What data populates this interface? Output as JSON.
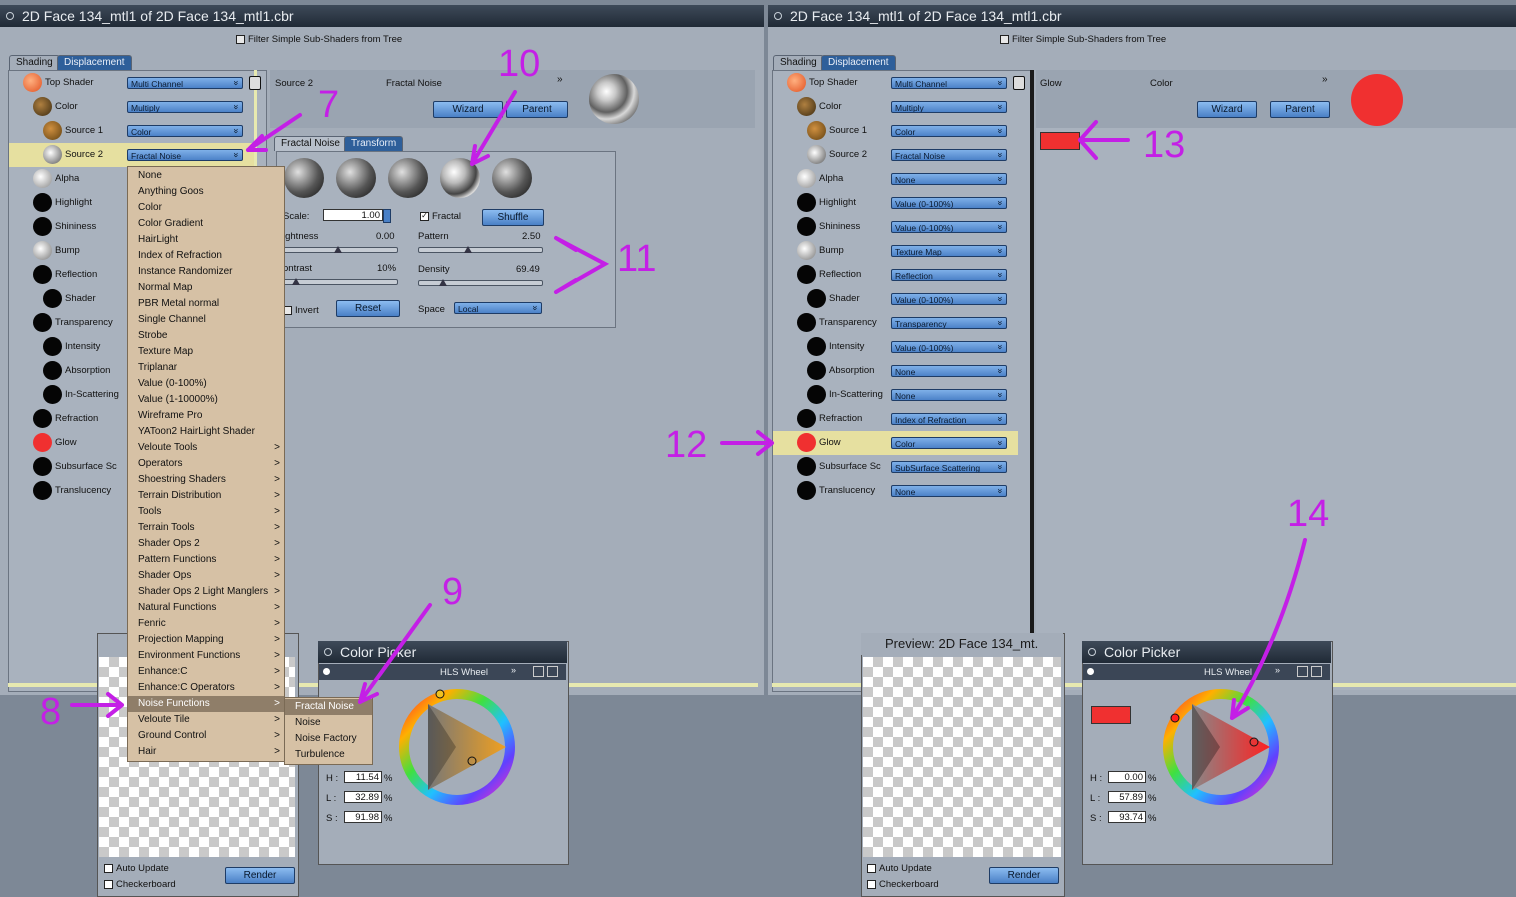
{
  "left_window": {
    "title": "2D Face 134_mtl1 of 2D Face 134_mtl1.cbr",
    "filter_label": "Filter Simple Sub-Shaders from Tree",
    "tabs": [
      "Shading",
      "Displacement"
    ],
    "tree": [
      {
        "label": "Top Shader",
        "value": "Multi Channel"
      },
      {
        "label": "Color",
        "value": "Multiply"
      },
      {
        "label": "Source 1",
        "value": "Color"
      },
      {
        "label": "Source 2",
        "value": "Fractal Noise"
      },
      {
        "label": "Alpha",
        "value": ""
      },
      {
        "label": "Highlight",
        "value": ""
      },
      {
        "label": "Shininess",
        "value": ""
      },
      {
        "label": "Bump",
        "value": ""
      },
      {
        "label": "Reflection",
        "value": ""
      },
      {
        "label": "Shader",
        "value": ""
      },
      {
        "label": "Transparency",
        "value": ""
      },
      {
        "label": "Intensity",
        "value": ""
      },
      {
        "label": "Absorption",
        "value": ""
      },
      {
        "label": "In-Scattering",
        "value": ""
      },
      {
        "label": "Refraction",
        "value": ""
      },
      {
        "label": "Glow",
        "value": ""
      },
      {
        "label": "Subsurface Sc",
        "value": ""
      },
      {
        "label": "Translucency",
        "value": ""
      }
    ],
    "source_header": {
      "name": "Source 2",
      "type": "Fractal Noise",
      "wizard": "Wizard",
      "parent": "Parent"
    },
    "subtabs": [
      "Fractal Noise",
      "Transform"
    ],
    "params": {
      "scale_label": "Scale:",
      "scale_value": "1.00",
      "fractal_label": "Fractal",
      "shuffle": "Shuffle",
      "brightness_label": "ightness",
      "brightness_value": "0.00",
      "pattern_label": "Pattern",
      "pattern_value": "2.50",
      "contrast_label": "ontrast",
      "contrast_value": "10%",
      "density_label": "Density",
      "density_value": "69.49",
      "invert_label": "Invert",
      "reset": "Reset",
      "space_label": "Space",
      "space_value": "Local"
    }
  },
  "context_menu": {
    "items": [
      {
        "label": "None",
        "sub": ""
      },
      {
        "label": "Anything Goos",
        "sub": ""
      },
      {
        "label": "Color",
        "sub": ""
      },
      {
        "label": "Color Gradient",
        "sub": ""
      },
      {
        "label": "HairLight",
        "sub": ""
      },
      {
        "label": "Index of Refraction",
        "sub": ""
      },
      {
        "label": "Instance Randomizer",
        "sub": ""
      },
      {
        "label": "Normal Map",
        "sub": ""
      },
      {
        "label": "PBR Metal normal",
        "sub": ""
      },
      {
        "label": "Single Channel",
        "sub": ""
      },
      {
        "label": "Strobe",
        "sub": ""
      },
      {
        "label": "Texture Map",
        "sub": ""
      },
      {
        "label": "Triplanar",
        "sub": ""
      },
      {
        "label": "Value (0-100%)",
        "sub": ""
      },
      {
        "label": "Value (1-10000%)",
        "sub": ""
      },
      {
        "label": "Wireframe Pro",
        "sub": ""
      },
      {
        "label": "YAToon2 HairLight Shader",
        "sub": ""
      },
      {
        "label": "Veloute Tools",
        "sub": ">"
      },
      {
        "label": "Operators",
        "sub": ">"
      },
      {
        "label": "Shoestring Shaders",
        "sub": ">"
      },
      {
        "label": "Terrain Distribution",
        "sub": ">"
      },
      {
        "label": "Tools",
        "sub": ">"
      },
      {
        "label": "Terrain Tools",
        "sub": ">"
      },
      {
        "label": "Shader Ops 2",
        "sub": ">"
      },
      {
        "label": "Pattern Functions",
        "sub": ">"
      },
      {
        "label": "Shader Ops",
        "sub": ">"
      },
      {
        "label": "Shader Ops 2 Light Manglers",
        "sub": ">"
      },
      {
        "label": "Natural Functions",
        "sub": ">"
      },
      {
        "label": "Fenric",
        "sub": ">"
      },
      {
        "label": "Projection Mapping",
        "sub": ">"
      },
      {
        "label": "Environment Functions",
        "sub": ">"
      },
      {
        "label": "Enhance:C",
        "sub": ">"
      },
      {
        "label": "Enhance:C Operators",
        "sub": ">"
      },
      {
        "label": "Noise Functions",
        "sub": ">"
      },
      {
        "label": "Veloute Tile",
        "sub": ">"
      },
      {
        "label": "Ground Control",
        "sub": ">"
      },
      {
        "label": "Hair",
        "sub": ">"
      }
    ],
    "submenu": [
      "Fractal Noise",
      "Noise",
      "Noise Factory",
      "Turbulence"
    ]
  },
  "left_preview": {
    "auto_update": "Auto Update",
    "checkerboard": "Checkerboard",
    "render": "Render"
  },
  "left_color_picker": {
    "title": "Color Picker",
    "mode": "HLS Wheel",
    "h": "11.54",
    "l": "32.89",
    "s": "91.98",
    "h_label": "H :",
    "l_label": "L :",
    "s_label": "S :",
    "pct": "%"
  },
  "right_window": {
    "title": "2D Face 134_mtl1 of 2D Face 134_mtl1.cbr",
    "filter_label": "Filter Simple Sub-Shaders from Tree",
    "tabs": [
      "Shading",
      "Displacement"
    ],
    "tree": [
      {
        "label": "Top Shader",
        "value": "Multi Channel"
      },
      {
        "label": "Color",
        "value": "Multiply"
      },
      {
        "label": "Source 1",
        "value": "Color"
      },
      {
        "label": "Source 2",
        "value": "Fractal Noise"
      },
      {
        "label": "Alpha",
        "value": "None"
      },
      {
        "label": "Highlight",
        "value": "Value (0-100%)"
      },
      {
        "label": "Shininess",
        "value": "Value (0-100%)"
      },
      {
        "label": "Bump",
        "value": "Texture Map"
      },
      {
        "label": "Reflection",
        "value": "Reflection"
      },
      {
        "label": "Shader",
        "value": "Value (0-100%)"
      },
      {
        "label": "Transparency",
        "value": "Transparency"
      },
      {
        "label": "Intensity",
        "value": "Value (0-100%)"
      },
      {
        "label": "Absorption",
        "value": "None"
      },
      {
        "label": "In-Scattering",
        "value": "None"
      },
      {
        "label": "Refraction",
        "value": "Index of Refraction"
      },
      {
        "label": "Glow",
        "value": "Color"
      },
      {
        "label": "Subsurface Sc",
        "value": "SubSurface Scattering"
      },
      {
        "label": "Translucency",
        "value": "None"
      }
    ],
    "glow_header": {
      "name": "Glow",
      "type": "Color",
      "wizard": "Wizard",
      "parent": "Parent"
    }
  },
  "right_preview": {
    "title": "Preview: 2D Face 134_mt.",
    "auto_update": "Auto Update",
    "checkerboard": "Checkerboard",
    "render": "Render"
  },
  "right_color_picker": {
    "title": "Color Picker",
    "mode": "HLS Wheel",
    "h": "0.00",
    "l": "57.89",
    "s": "93.74",
    "h_label": "H :",
    "l_label": "L :",
    "s_label": "S :",
    "pct": "%"
  },
  "annotations": [
    "7",
    "8",
    "9",
    "10",
    "11",
    "12",
    "13",
    "14"
  ],
  "colors": {
    "glow_red": "#f03030",
    "selection": "#e6e0a0",
    "menu_bg": "#d6c1a5",
    "annotation": "#c41fe6",
    "dropdown": "#5a8fd2"
  }
}
